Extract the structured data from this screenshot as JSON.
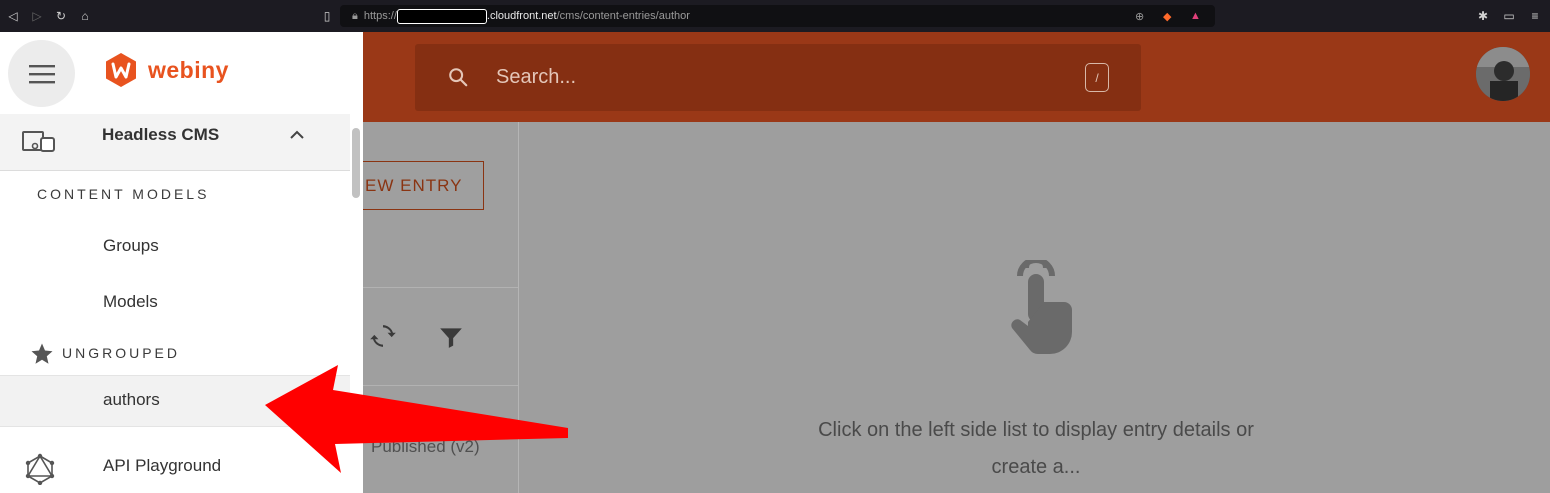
{
  "browser": {
    "url_prefix": "https://",
    "url_host": ".cloudfront.net",
    "url_path": "/cms/content-entries/author"
  },
  "header": {
    "logo_text": "webiny",
    "search_placeholder": "Search...",
    "search_shortcut": "/"
  },
  "sidebar": {
    "app_label": "Headless CMS",
    "section_content_models": "CONTENT MODELS",
    "items": [
      "Groups",
      "Models"
    ],
    "section_ungrouped": "UNGROUPED",
    "active_item": "authors",
    "api_playground": "API Playground"
  },
  "list": {
    "new_entry_partial": "EW ENTRY",
    "status_partial": "Published (v2)"
  },
  "main": {
    "empty_message": "Click on the left side list to display entry details or create a..."
  },
  "colors": {
    "brand": "#e8531f",
    "header_bg": "#9a3817",
    "annotation_arrow": "#ff0000"
  }
}
